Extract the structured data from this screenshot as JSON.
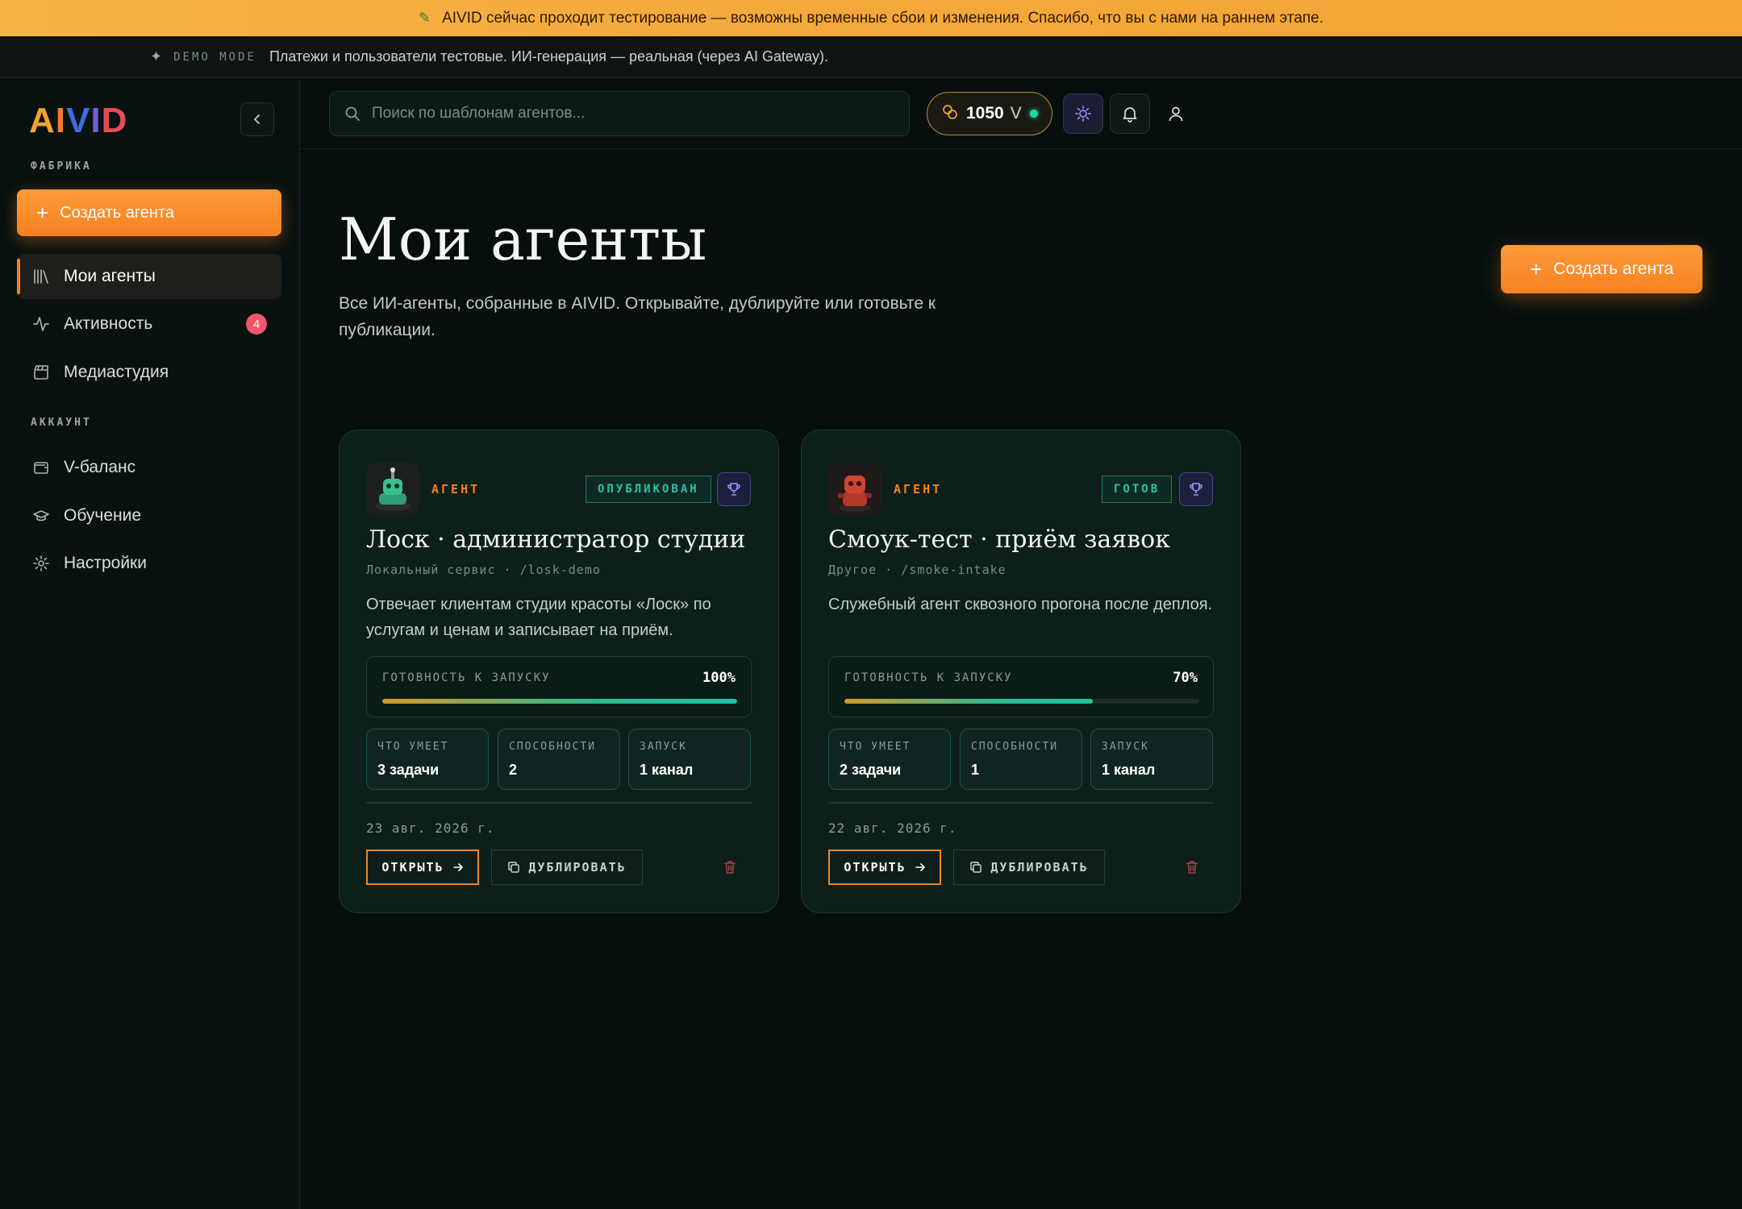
{
  "banner": {
    "text": "AIVID сейчас проходит тестирование — возможны временные сбои и изменения. Спасибо, что вы с нами на раннем этапе."
  },
  "demo_bar": {
    "tag": "DEMO MODE",
    "text": "Платежи и пользователи тестовые. ИИ-генерация — реальная (через AI Gateway)."
  },
  "sidebar": {
    "logo": "AIVID",
    "section_factory": "ФАБРИКА",
    "create_label": "Создать агента",
    "items": [
      {
        "label": "Мои агенты",
        "icon": "library-icon",
        "active": true
      },
      {
        "label": "Активность",
        "icon": "activity-icon",
        "badge": "4"
      },
      {
        "label": "Медиастудия",
        "icon": "clapperboard-icon"
      }
    ],
    "section_account": "АККАУНТ",
    "account_items": [
      {
        "label": "V-баланс",
        "icon": "wallet-icon"
      },
      {
        "label": "Обучение",
        "icon": "graduation-cap-icon"
      },
      {
        "label": "Настройки",
        "icon": "gear-icon"
      }
    ]
  },
  "header": {
    "search_placeholder": "Поиск по шаблонам агентов...",
    "balance": "1050",
    "balance_unit": "V"
  },
  "main": {
    "title": "Мои агенты",
    "subtitle": "Все ИИ-агенты, собранные в AIVID. Открывайте, дублируйте или готовьте к публикации.",
    "create_label": "Создать агента"
  },
  "cards": [
    {
      "kind": "АГЕНТ",
      "status": "ОПУБЛИКОВАН",
      "title": "Лоск · администратор студии",
      "slug": "Локальный сервис · /losk-demo",
      "description": "Отвечает клиентам студии красоты «Лоск» по услугам и ценам и записывает на приём.",
      "readiness_label": "ГОТОВНОСТЬ К ЗАПУСКУ",
      "readiness_value": "100%",
      "readiness_fraction": 1.0,
      "stats": [
        {
          "label": "ЧТО УМЕЕТ",
          "value": "3 задачи"
        },
        {
          "label": "СПОСОБНОСТИ",
          "value": "2"
        },
        {
          "label": "ЗАПУСК",
          "value": "1 канал"
        }
      ],
      "date": "23 авг. 2026 г.",
      "open_label": "ОТКРЫТЬ",
      "duplicate_label": "ДУБЛИРОВАТЬ",
      "avatar_color": "#2fa07a"
    },
    {
      "kind": "АГЕНТ",
      "status": "ГОТОВ",
      "title": "Смоук-тест · приём заявок",
      "slug": "Другое · /smoke-intake",
      "description": "Служебный агент сквозного прогона после деплоя.",
      "readiness_label": "ГОТОВНОСТЬ К ЗАПУСКУ",
      "readiness_value": "70%",
      "readiness_fraction": 0.7,
      "stats": [
        {
          "label": "ЧТО УМЕЕТ",
          "value": "2 задачи"
        },
        {
          "label": "СПОСОБНОСТИ",
          "value": "1"
        },
        {
          "label": "ЗАПУСК",
          "value": "1 канал"
        }
      ],
      "date": "22 авг. 2026 г.",
      "open_label": "ОТКРЫТЬ",
      "duplicate_label": "ДУБЛИРОВАТЬ",
      "avatar_color": "#d0452f"
    }
  ],
  "colors": {
    "accent": "#f5821f",
    "teal": "#2fc1a0",
    "background": "#060f0d"
  }
}
